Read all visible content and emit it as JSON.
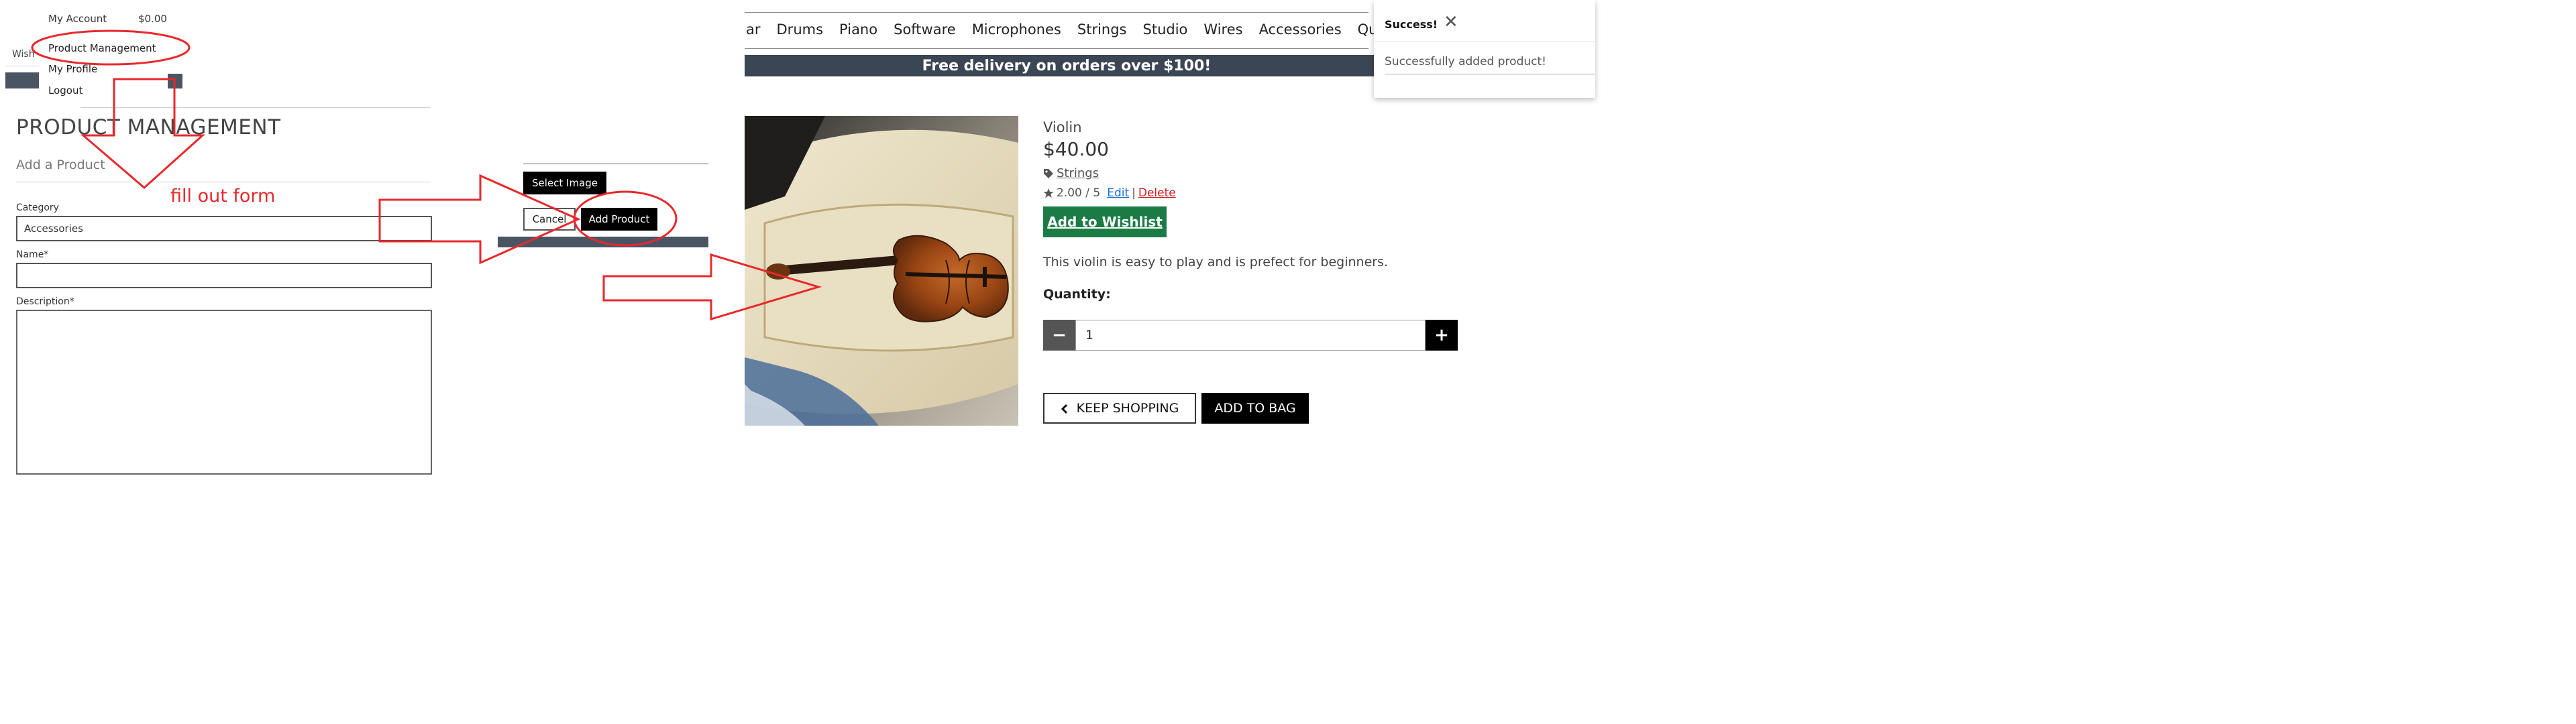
{
  "colors": {
    "annotation_red": "#e8282c",
    "banner_bg": "#3b4654",
    "wishlist_green": "#1b7b45"
  },
  "header": {
    "my_account": "My Account",
    "bag_total": "$0.00",
    "wishlist_tab": "Wish"
  },
  "account_dropdown": {
    "items": [
      "Product Management",
      "My Profile",
      "Logout"
    ]
  },
  "product_management": {
    "title": "PRODUCT MANAGEMENT",
    "subtitle": "Add a Product",
    "category_label": "Category",
    "category_value": "Accessories",
    "name_label": "Name*",
    "name_value": "",
    "description_label": "Description*",
    "description_value": "",
    "select_image_label": "Select Image",
    "cancel_label": "Cancel",
    "add_product_label": "Add Product"
  },
  "annotation": {
    "fill_out_form": "fill out form"
  },
  "shop_nav": {
    "items": [
      "ar",
      "Drums",
      "Piano",
      "Software",
      "Microphones",
      "Strings",
      "Studio",
      "Wires",
      "Accessories",
      "Questions"
    ]
  },
  "banner": {
    "text": "Free delivery on orders over $100!"
  },
  "product": {
    "name": "Violin",
    "price": "$40.00",
    "category": "Strings",
    "rating": "2.00 / 5",
    "edit_label": "Edit",
    "separator": "|",
    "delete_label": "Delete",
    "wishlist_label": "Add to Wishlist",
    "description": "This violin is easy to play and is prefect for beginners.",
    "quantity_label": "Quantity:",
    "quantity_value": "1",
    "minus_symbol": "−",
    "plus_symbol": "+",
    "keep_shopping_label": "KEEP SHOPPING",
    "add_to_bag_label": "ADD TO BAG",
    "icons": {
      "category": "tag-icon",
      "rating": "star-icon",
      "back": "chevron-left-icon"
    }
  },
  "toast": {
    "title": "Success!",
    "message": "Successfully added product!",
    "close_symbol": "✕"
  }
}
